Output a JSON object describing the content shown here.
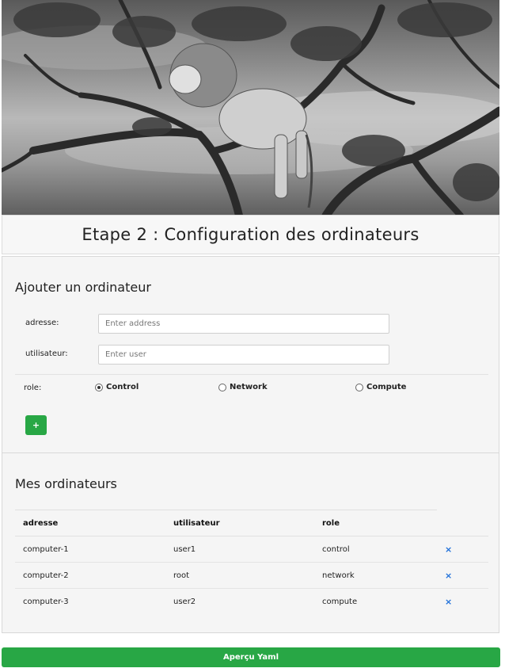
{
  "page": {
    "title": "Etape 2 : Configuration des ordinateurs",
    "hero_image": "lion-in-tree-photo"
  },
  "add_form": {
    "heading": "Ajouter un ordinateur",
    "address_label": "adresse:",
    "address_placeholder": "Enter address",
    "address_value": "",
    "user_label": "utilisateur:",
    "user_placeholder": "Enter user",
    "user_value": "",
    "role_label": "role:",
    "roles": [
      {
        "label": "Control",
        "selected": true
      },
      {
        "label": "Network",
        "selected": false
      },
      {
        "label": "Compute",
        "selected": false
      }
    ],
    "add_button_label": "+",
    "accent_color": "#28a745"
  },
  "computers": {
    "heading": "Mes ordinateurs",
    "columns": [
      "adresse",
      "utilisateur",
      "role"
    ],
    "rows": [
      {
        "adresse": "computer-1",
        "utilisateur": "user1",
        "role": "control",
        "delete": "×"
      },
      {
        "adresse": "computer-2",
        "utilisateur": "root",
        "role": "network",
        "delete": "×"
      },
      {
        "adresse": "computer-3",
        "utilisateur": "user2",
        "role": "compute",
        "delete": "×"
      }
    ],
    "delete_color": "#1e6fd9"
  },
  "footer": {
    "preview_button_label": "Aperçu Yaml"
  }
}
